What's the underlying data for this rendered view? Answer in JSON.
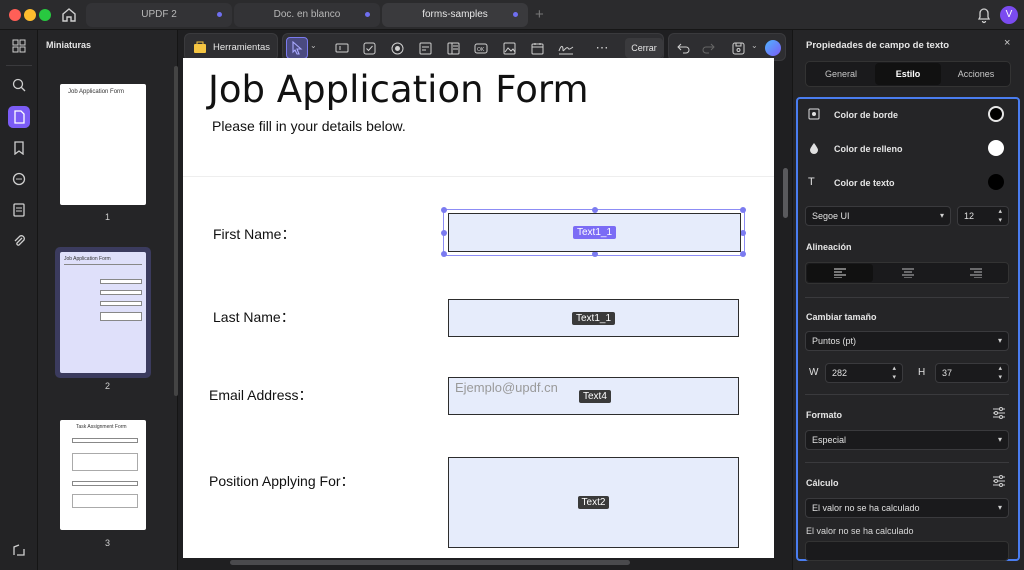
{
  "tabs": [
    {
      "label": "UPDF 2"
    },
    {
      "label": "Doc. en blanco"
    },
    {
      "label": "forms-samples"
    }
  ],
  "user_initial": "V",
  "thumbnails": {
    "title": "Miniaturas",
    "pages": [
      {
        "number": "1",
        "heading": "Job Application Form"
      },
      {
        "number": "2",
        "heading": "Job Application Form"
      },
      {
        "number": "3",
        "heading": "Task Assignment Form"
      }
    ]
  },
  "toolbar": {
    "tools_label": "Herramientas",
    "close_label": "Cerrar"
  },
  "document": {
    "title": "Job Application Form",
    "subtitle": "Please fill in your details below.",
    "fields": [
      {
        "label": "First Name：",
        "tag": "Text1_1",
        "placeholder": ""
      },
      {
        "label": "Last Name：",
        "tag": "Text1_1",
        "placeholder": ""
      },
      {
        "label": "Email Address：",
        "tag": "Text4",
        "placeholder": "Ejemplo@updf.cn"
      },
      {
        "label": "Position Applying For：",
        "tag": "Text2",
        "placeholder": ""
      }
    ]
  },
  "panel": {
    "title": "Propiedades de campo de texto",
    "tabs": [
      "General",
      "Estilo",
      "Acciones"
    ],
    "active_tab": "Estilo",
    "border_color_label": "Color de borde",
    "fill_color_label": "Color de relleno",
    "text_color_label": "Color de texto",
    "font": "Segoe UI",
    "font_size": "12",
    "alignment_label": "Alineación",
    "resize_label": "Cambiar tamaño",
    "unit": "Puntos (pt)",
    "w_label": "W",
    "w_value": "282",
    "h_label": "H",
    "h_value": "37",
    "format_label": "Formato",
    "format_value": "Especial",
    "calc_label": "Cálculo",
    "calc_value": "El valor no se ha calculado",
    "calc_note": "El valor no se ha calculado"
  },
  "colors": {
    "accent": "#6b6bf0",
    "border_swatch": "#000000",
    "fill_swatch": "#ffffff",
    "text_swatch": "#000000"
  }
}
